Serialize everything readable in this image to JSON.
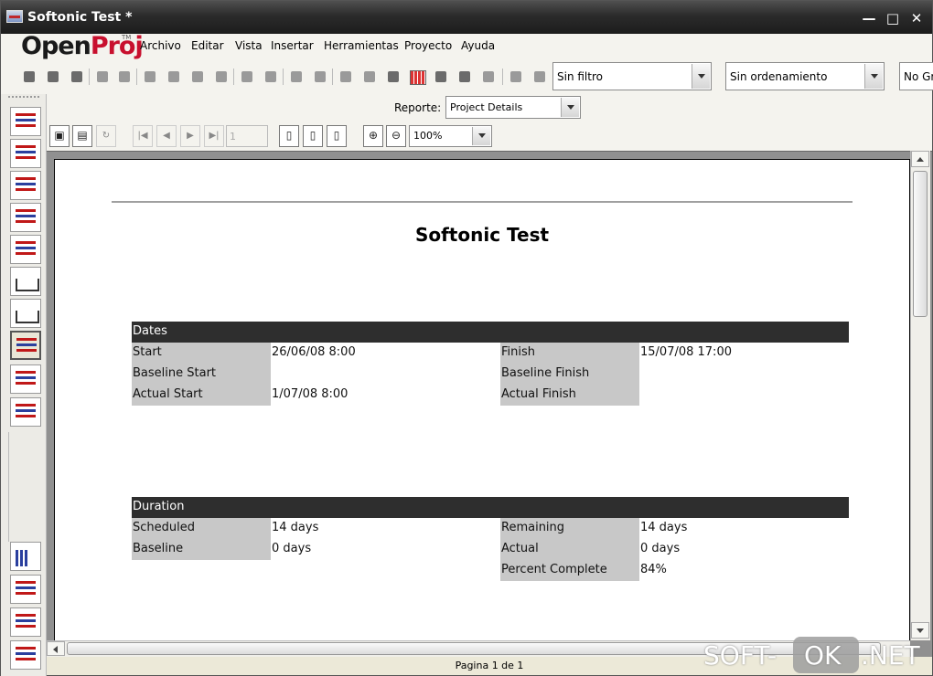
{
  "window": {
    "title": "Softonic Test *"
  },
  "logo": {
    "open": "Open",
    "proj": "Proj",
    "tm": "TM"
  },
  "menu": [
    "Archivo",
    "Editar",
    "Vista",
    "Insertar",
    "Herramientas",
    "Proyecto",
    "Ayuda"
  ],
  "toolbar": {
    "filter": "Sin filtro",
    "sort": "Sin ordenamiento",
    "group": "No Gr"
  },
  "report": {
    "label": "Reporte:",
    "value": "Project Details"
  },
  "preview": {
    "page": "1",
    "zoom": "100%"
  },
  "document": {
    "title": "Softonic Test",
    "sections": [
      {
        "header": "Dates",
        "rows": [
          {
            "label": "Start",
            "value": "26/06/08 8:00",
            "label2": "Finish",
            "value2": "15/07/08 17:00"
          },
          {
            "label": "Baseline Start",
            "value": "",
            "label2": "Baseline Finish",
            "value2": ""
          },
          {
            "label": "Actual Start",
            "value": "1/07/08 8:00",
            "label2": "Actual Finish",
            "value2": ""
          }
        ]
      },
      {
        "header": "Duration",
        "rows": [
          {
            "label": "Scheduled",
            "value": "14 days",
            "label2": "Remaining",
            "value2": "14 days"
          },
          {
            "label": "Baseline",
            "value": "0 days",
            "label2": "Actual",
            "value2": "0 days"
          },
          {
            "label": "",
            "value": "",
            "label2": "Percent Complete",
            "value2": "84%"
          }
        ]
      }
    ]
  },
  "status": {
    "page_indicator": "Pagina 1 de 1"
  },
  "watermark": {
    "soft": "SOFT-",
    "ok": "OK",
    "net": ".NET"
  }
}
